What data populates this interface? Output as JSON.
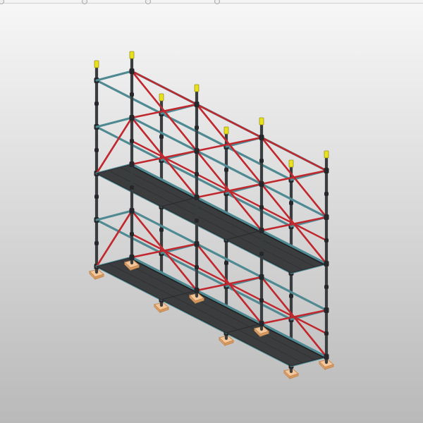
{
  "colors": {
    "background_top": "#f7f7f7",
    "background_bottom": "#b9b9b9",
    "standard": "#3a3d40",
    "standard_joint": "#25272a",
    "ledger": "#4f8a93",
    "diagonal_brace": "#c1282e",
    "deck": "#3b3c3e",
    "deck_edge": "#2a2b2d",
    "base_plate": "#f3c79a",
    "base_plate_edge": "#c48a55",
    "top_cap": "#e8e020"
  },
  "scaffold": {
    "bays": 3,
    "frames": 4,
    "decked_levels": 2,
    "decked_level_indices": [
      0,
      2
    ],
    "lift_heights": [
      0,
      1,
      2,
      3,
      4
    ]
  },
  "components": [
    {
      "name": "standard",
      "icon": "vertical-post-icon"
    },
    {
      "name": "ledger",
      "icon": "horizontal-rail-icon"
    },
    {
      "name": "diagonal-brace",
      "icon": "cross-brace-icon"
    },
    {
      "name": "deck",
      "icon": "platform-icon"
    },
    {
      "name": "base-plate",
      "icon": "base-plate-icon"
    },
    {
      "name": "top-cap",
      "icon": "cap-icon"
    }
  ]
}
